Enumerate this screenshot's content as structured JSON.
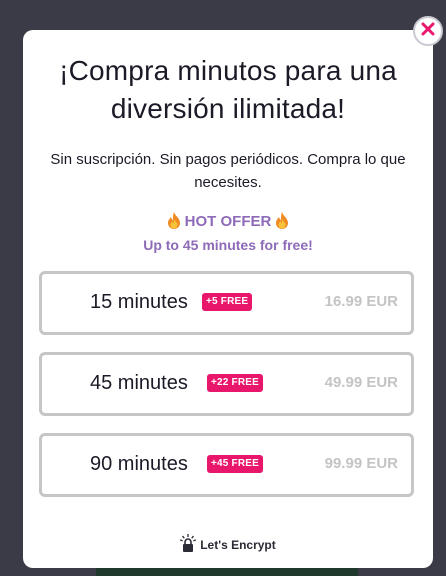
{
  "modal": {
    "title_line1": "¡Compra minutos para una",
    "title_line2": "diversión ilimitada!",
    "subtitle_line1": "Sin suscripción. Sin pagos periódicos. Compra lo que",
    "subtitle_line2": "necesites.",
    "offer_label": "HOT OFFER",
    "offer_subtitle": "Up to 45 minutes for free!",
    "close_icon": "close-x-icon",
    "flame_icon": "fire-emoji-icon",
    "accent_color": "#e8176b",
    "offer_color": "#8d6bb8",
    "plans": [
      {
        "name": "15 minutes",
        "badge": "+5 FREE",
        "price": "16.99 EUR"
      },
      {
        "name": "45 minutes",
        "badge": "+22 FREE",
        "price": "49.99 EUR"
      },
      {
        "name": "90 minutes",
        "badge": "+45 FREE",
        "price": "99.99 EUR"
      }
    ],
    "footer": {
      "encrypt_label": "Let's Encrypt",
      "icon": "lets-encrypt-lock-icon"
    }
  }
}
